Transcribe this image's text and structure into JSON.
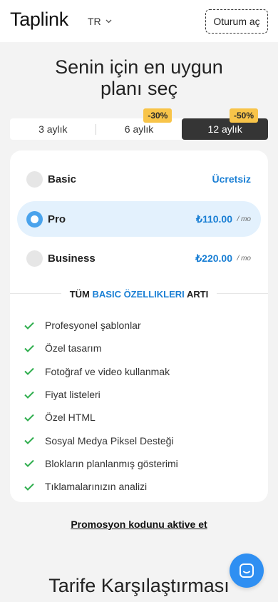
{
  "header": {
    "logo": "Taplink",
    "language": "TR",
    "login_label": "Oturum aç"
  },
  "headline": {
    "line1": "Senin için en uygun",
    "line2": "planı seç"
  },
  "period_tabs": [
    {
      "label": "3 aylık",
      "discount": ""
    },
    {
      "label": "6 aylık",
      "discount": "-30%"
    },
    {
      "label": "12 aylık",
      "discount": "-50%",
      "selected": true
    }
  ],
  "plans": [
    {
      "name": "Basic",
      "price": "Ücretsiz",
      "per": ""
    },
    {
      "name": "Pro",
      "price": "₺110.00",
      "per": "/ mo",
      "selected": true
    },
    {
      "name": "Business",
      "price": "₺220.00",
      "per": "/ mo"
    }
  ],
  "features_header": {
    "prefix": "TÜM",
    "highlight": "BASIC ÖZELLIKLERI",
    "suffix": "ARTI"
  },
  "features": [
    "Profesyonel şablonlar",
    "Özel tasarım",
    "Fotoğraf ve video kullanmak",
    "Fiyat listeleri",
    "Özel HTML",
    "Sosyal Medya Piksel Desteği",
    "Blokların planlanmış gösterimi",
    "Tıklamalarınızın analizi"
  ],
  "promo_link": "Promosyon kodunu aktive et",
  "comparison_title": "Tarife Karşılaştırması",
  "colors": {
    "accent": "#1a7fd4",
    "selected_plan_bg": "#e3f1fd",
    "radio_on": "#4aa3ec",
    "badge": "#f8c449",
    "active_tab": "#353535",
    "check": "#2fae4e",
    "chat_button": "#2f8ff2"
  },
  "icons": {
    "language_chevron": "chevron-down-icon",
    "feature_check": "check-icon",
    "chat": "chat-bubble-icon"
  }
}
